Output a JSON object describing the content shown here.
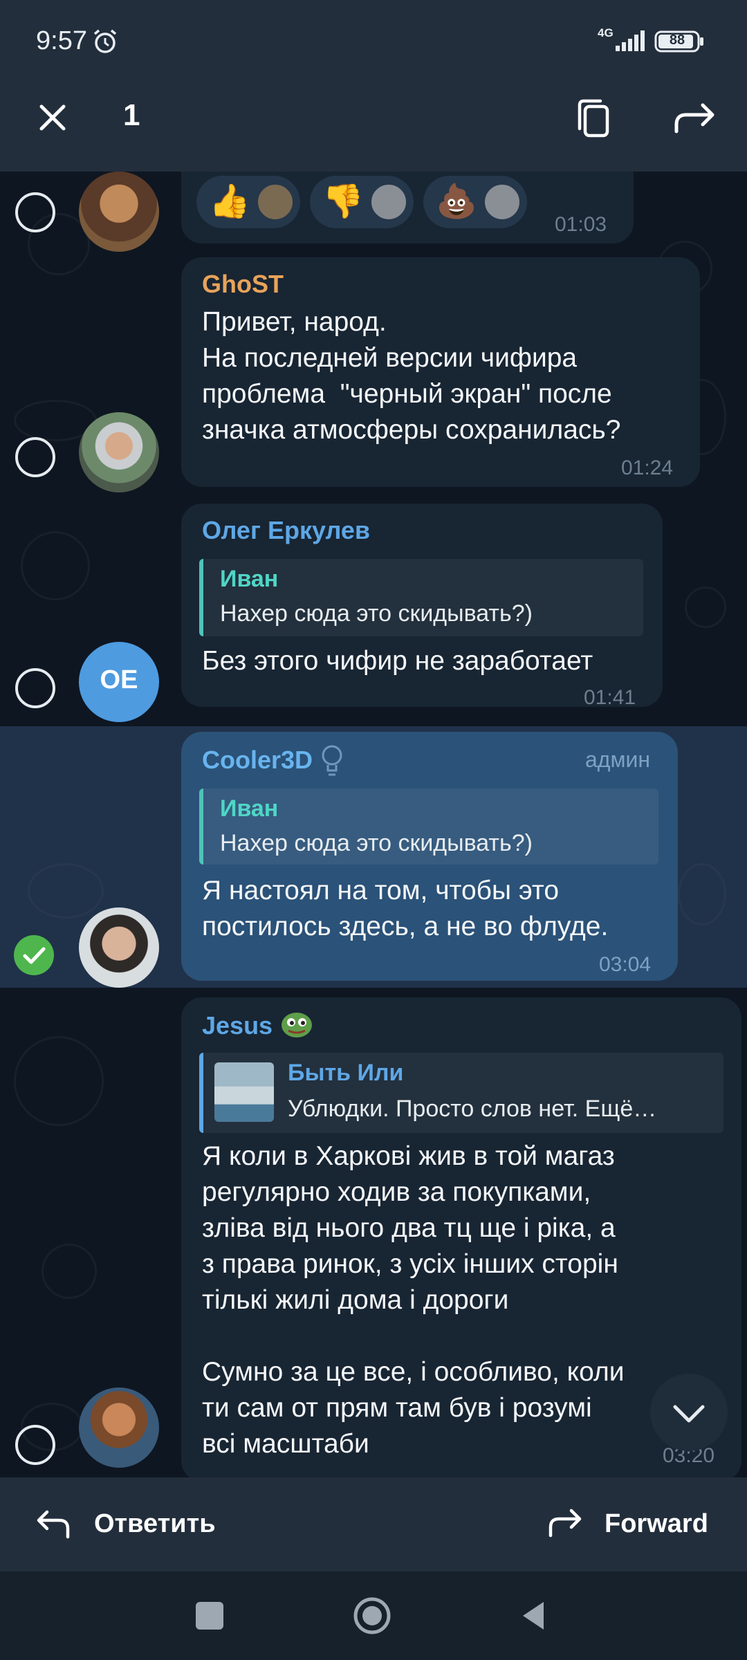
{
  "status_bar": {
    "time": "9:57",
    "network": "4G",
    "battery": "88"
  },
  "top_bar": {
    "selected_count": "1"
  },
  "reactions_message": {
    "reactions": [
      {
        "emoji": "👍",
        "icon": "thumbs-up"
      },
      {
        "emoji": "👎",
        "icon": "thumbs-down"
      },
      {
        "emoji": "💩",
        "icon": "pile-of-poo"
      }
    ],
    "time": "01:03"
  },
  "messages": [
    {
      "sender": "GhoST",
      "sender_color": "#e8a35a",
      "text": "Привет, народ.\nНа последней версии чифира\nпроблема  \"черный экран\" после\nзначка атмосферы сохранилась?",
      "time": "01:24"
    },
    {
      "sender": "Олег Еркулев",
      "sender_color": "#5ea7e6",
      "avatar_initials": "OE",
      "reply_name": "Иван",
      "reply_text": "Нахер сюда это скидывать?)",
      "text": "Без этого чифир не заработает",
      "time": "01:41"
    },
    {
      "sender": "Cooler3D",
      "sender_color": "#68b4ef",
      "role": "админ",
      "reply_name": "Иван",
      "reply_text": "Нахер сюда это скидывать?)",
      "text": "Я настоял на том, чтобы это\nпостилось здесь, а не во флуде.",
      "time": "03:04"
    },
    {
      "sender": "Jesus",
      "sender_color": "#5ea7e6",
      "reply_name": "Быть Или",
      "reply_text": "Ублюдки. Просто слов нет. Ещё…",
      "text": "Я коли в Харкові жив в той магаз\nрегулярно ходив за покупками,\nзліва від нього два тц ще і ріка, а\nз права ринок, з усіх інших сторін\nтількі жилі дома і дороги\n\nСумно за це все, і особливо, коли\nти сам от прям там був і розумі\nвсі масштаби",
      "time": "03:20"
    }
  ],
  "bottom_bar": {
    "reply_label": "Ответить",
    "forward_label": "Forward"
  },
  "colors": {
    "accent": "#5ea7e6",
    "checked": "#4fb64e",
    "bubble": "#182533",
    "selected_bubble": "#2b5278"
  }
}
